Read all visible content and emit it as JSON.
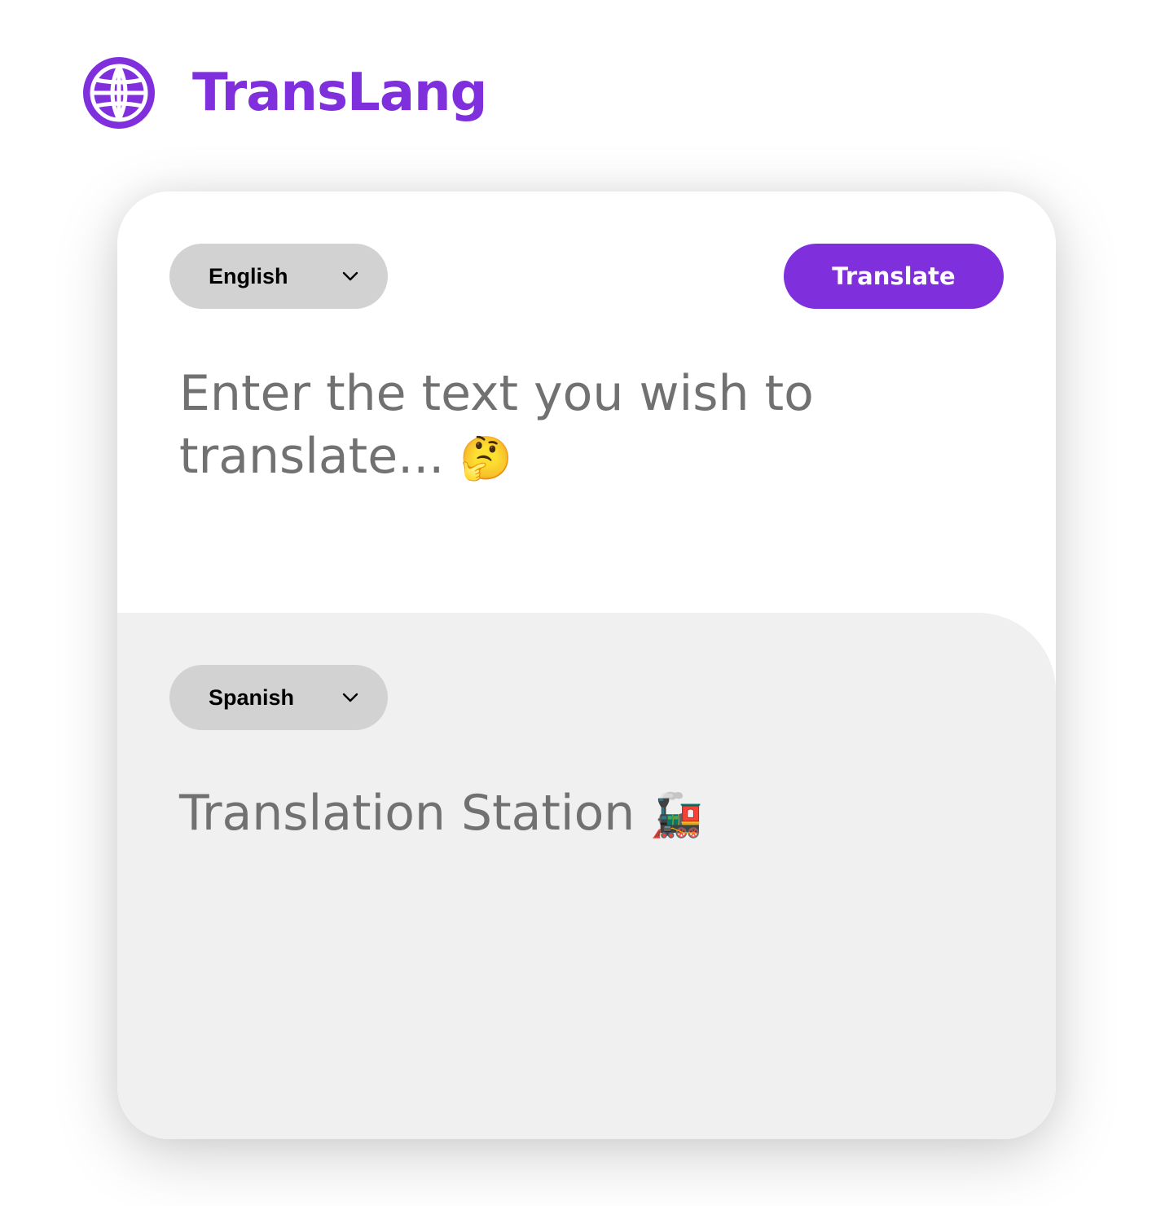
{
  "colors": {
    "brand": "#7f2fdb",
    "lang_select_bg": "#d2d2d2",
    "target_section_bg": "#f0f0f0",
    "placeholder_text": "#717171"
  },
  "header": {
    "logo_icon": "globe-icon",
    "title": "TransLang"
  },
  "source": {
    "language": "English",
    "dropdown_icon": "chevron-down-icon",
    "translate_label": "Translate",
    "placeholder": "Enter the text you wish to translate...",
    "placeholder_emoji": "🤔"
  },
  "target": {
    "language": "Spanish",
    "dropdown_icon": "chevron-down-icon",
    "output_text": "Translation Station",
    "output_emoji": "🚂"
  }
}
